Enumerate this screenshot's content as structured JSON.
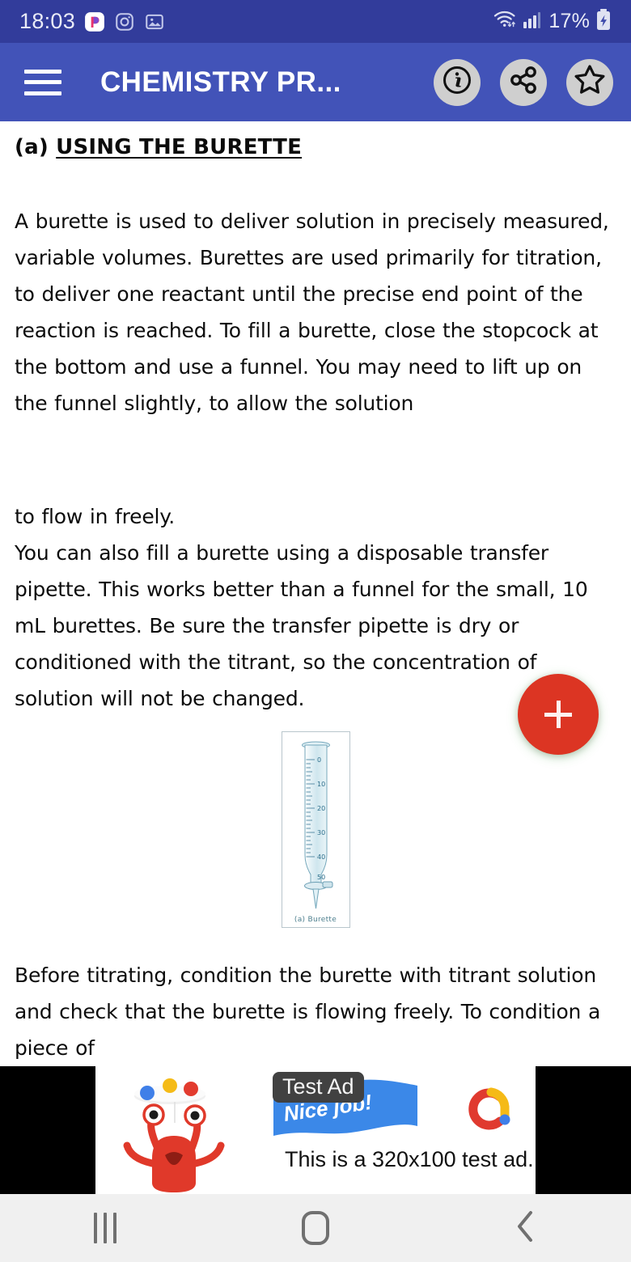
{
  "status_bar": {
    "clock": "18:03",
    "battery_percent": "17%",
    "icons": [
      "p-app-icon",
      "instagram-icon",
      "gallery-image-icon",
      "wifi-icon",
      "cellular-signal-icon",
      "battery-charging-icon"
    ],
    "background_color": "#323c9b"
  },
  "app_bar": {
    "title": "CHEMISTRY PR...",
    "menu_icon": "hamburger-menu-icon",
    "actions": [
      {
        "name": "info",
        "icon": "info-icon"
      },
      {
        "name": "share",
        "icon": "share-icon"
      },
      {
        "name": "favorite",
        "icon": "star-icon"
      }
    ],
    "background_color": "#4253b8",
    "title_color": "#ffffff"
  },
  "document": {
    "heading_prefix": "(a) ",
    "heading": "USING THE BURETTE",
    "paragraph_1": "A burette is used to deliver solution in precisely measured, variable volumes. Burettes are used primarily for titration, to deliver one reactant until the precise end point of the reaction is reached. To fill a burette, close the stopcock at the bottom and use a funnel. You may need to lift up on the funnel slightly, to allow the solution",
    "paragraph_2": "to flow in freely.",
    "paragraph_3": " You can also fill a burette using a disposable transfer pipette. This works better than a funnel for the small, 10 mL burettes. Be sure the transfer pipette is dry or conditioned with the titrant, so the concentration of solution will not be changed.",
    "paragraph_4": "Before titrating, condition the burette with titrant solution and check that the burette is flowing freely. To condition a piece of"
  },
  "figure": {
    "caption": "(a) Burette",
    "scale_labels": [
      "0",
      "10",
      "20",
      "30",
      "40",
      "50"
    ],
    "glass_color": "#7fb4c8"
  },
  "fab": {
    "icon": "plus-icon",
    "label": "+",
    "color": "#dc3523"
  },
  "ad": {
    "badge": "Test Ad",
    "ribbon_text": "Nice job!",
    "body_text": "This is a 320x100 test ad.",
    "logo": "admob-logo-icon",
    "badge_color": "#414141",
    "ribbon_color": "#3b88e8",
    "background_color": "#000000"
  },
  "nav_bar": {
    "buttons": [
      {
        "name": "recents",
        "icon": "recents-icon"
      },
      {
        "name": "home",
        "icon": "home-icon"
      },
      {
        "name": "back",
        "icon": "back-chevron-icon"
      }
    ],
    "background_color": "#f0f0f0"
  }
}
